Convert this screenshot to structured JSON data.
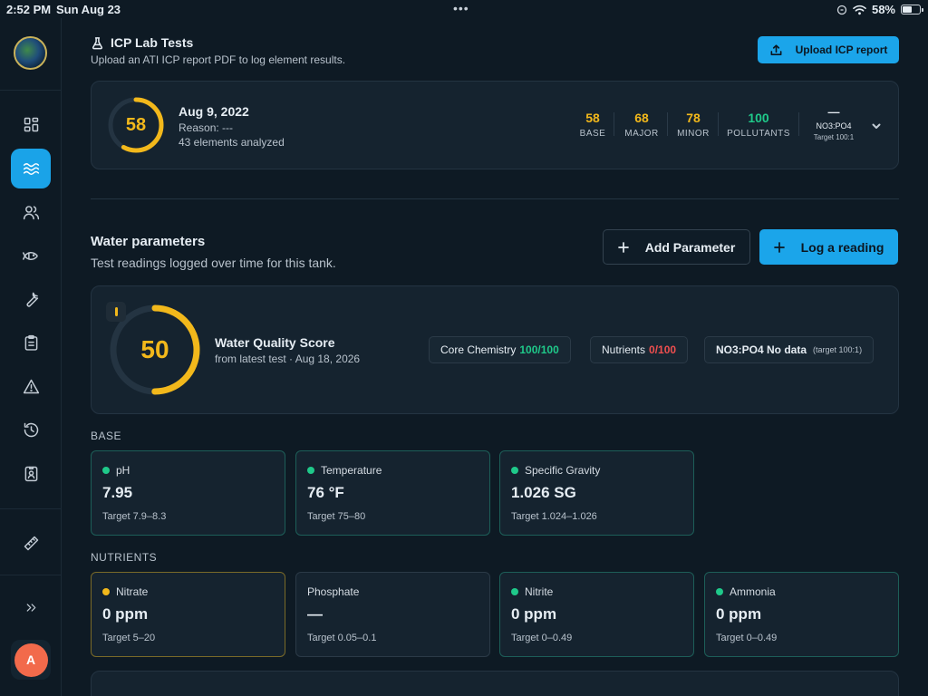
{
  "status_bar": {
    "time": "2:52 PM",
    "date": "Sun Aug 23",
    "battery": "58%",
    "battery_level": 0.58
  },
  "sidebar": {
    "items": [
      {
        "name": "dashboard",
        "icon": "grid-icon",
        "active": false
      },
      {
        "name": "water",
        "icon": "waves-icon",
        "active": true
      },
      {
        "name": "users",
        "icon": "users-icon",
        "active": false
      },
      {
        "name": "livestock",
        "icon": "fish-icon",
        "active": false
      },
      {
        "name": "equipment",
        "icon": "wrench-icon",
        "active": false
      },
      {
        "name": "tasks",
        "icon": "clipboard-icon",
        "active": false
      },
      {
        "name": "alerts",
        "icon": "warning-icon",
        "active": false
      },
      {
        "name": "history",
        "icon": "history-icon",
        "active": false
      },
      {
        "name": "profile",
        "icon": "id-card-icon",
        "active": false
      },
      {
        "name": "tools",
        "icon": "ruler-icon",
        "active": false
      }
    ],
    "expand_icon": "double-chevron-right-icon",
    "avatar_initial": "A",
    "active_color": "#1aa3e8"
  },
  "icp": {
    "title": "ICP Lab Tests",
    "subtitle": "Upload an ATI ICP report PDF to log element results.",
    "upload_label": "Upload ICP report",
    "score": "58",
    "score_fraction": 0.58,
    "date": "Aug 9, 2022",
    "reason": "Reason: ---",
    "elements": "43 elements analyzed",
    "stats": [
      {
        "value": "58",
        "label": "BASE",
        "color": "#f2b81b"
      },
      {
        "value": "68",
        "label": "MAJOR",
        "color": "#f2b81b"
      },
      {
        "value": "78",
        "label": "MINOR",
        "color": "#f2b81b"
      },
      {
        "value": "100",
        "label": "POLLUTANTS",
        "color": "#1fc98a"
      }
    ],
    "ratio": {
      "value": "—",
      "label": "NO3:PO4",
      "target": "Target 100:1"
    }
  },
  "water_params": {
    "title": "Water parameters",
    "subtitle": "Test readings logged over time for this tank.",
    "add_label": "Add Parameter",
    "log_label": "Log a reading"
  },
  "quality": {
    "score": "50",
    "score_fraction": 0.5,
    "title": "Water Quality Score",
    "subtitle": "from latest test · Aug 18, 2026",
    "pills": {
      "core_label": "Core Chemistry",
      "core_value": "100/100",
      "nutrients_label": "Nutrients",
      "nutrients_value": "0/100",
      "ratio_label": "NO3:PO4 No data",
      "ratio_target": "(target 100:1)"
    }
  },
  "base": {
    "label": "BASE",
    "cards": [
      {
        "name": "pH",
        "value": "7.95",
        "target": "Target 7.9–8.3",
        "status": "good"
      },
      {
        "name": "Temperature",
        "value": "76 °F",
        "target": "Target 75–80",
        "status": "good"
      },
      {
        "name": "Specific Gravity",
        "value": "1.026 SG",
        "target": "Target 1.024–1.026",
        "status": "good"
      }
    ]
  },
  "nutrients": {
    "label": "NUTRIENTS",
    "cards": [
      {
        "name": "Nitrate",
        "value": "0 ppm",
        "target": "Target 5–20",
        "status": "warn"
      },
      {
        "name": "Phosphate",
        "value": "—",
        "target": "Target 0.05–0.1",
        "status": "none"
      },
      {
        "name": "Nitrite",
        "value": "0 ppm",
        "target": "Target 0–0.49",
        "status": "good"
      },
      {
        "name": "Ammonia",
        "value": "0 ppm",
        "target": "Target 0–0.49",
        "status": "good"
      }
    ]
  },
  "colors": {
    "accent": "#1ba5ea",
    "good": "#1fc98a",
    "warn": "#f2b81b",
    "bad": "#ef4f4f"
  }
}
